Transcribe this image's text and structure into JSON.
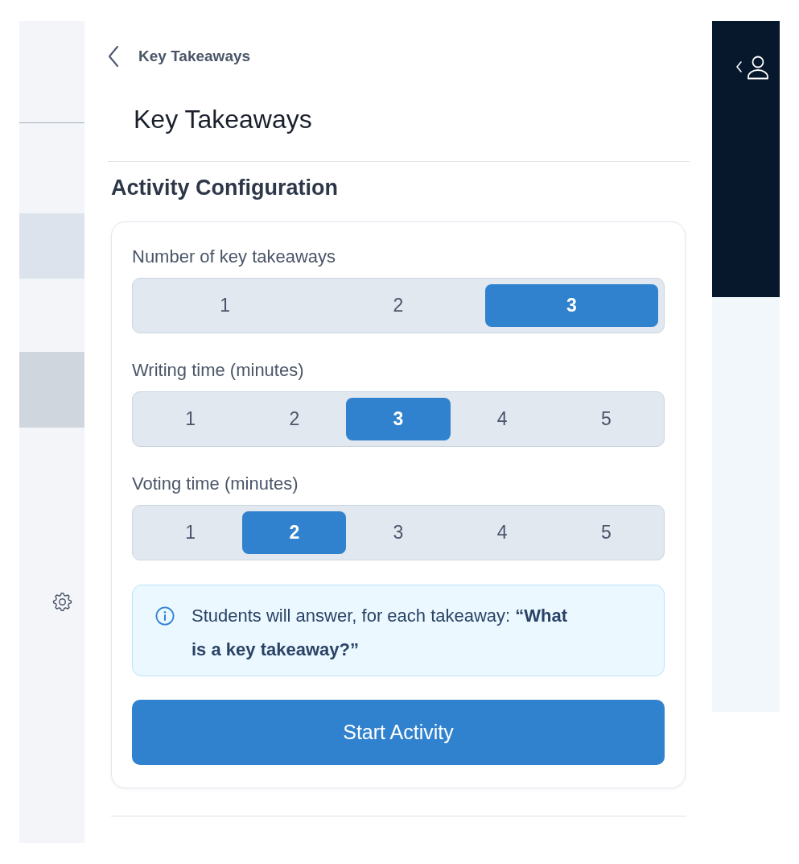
{
  "back_link": {
    "label": "Key Takeaways"
  },
  "title": "Key Takeaways",
  "section_title": "Activity Configuration",
  "settings": [
    {
      "label": "Number of key takeaways",
      "options": [
        {
          "label": "1",
          "selected": false
        },
        {
          "label": "2",
          "selected": false
        },
        {
          "label": "3",
          "selected": true
        }
      ]
    },
    {
      "label": "Writing time (minutes)",
      "options": [
        {
          "label": "1",
          "selected": false
        },
        {
          "label": "2",
          "selected": false
        },
        {
          "label": "3",
          "selected": true
        },
        {
          "label": "4",
          "selected": false
        },
        {
          "label": "5",
          "selected": false
        }
      ]
    },
    {
      "label": "Voting time (minutes)",
      "options": [
        {
          "label": "1",
          "selected": false
        },
        {
          "label": "2",
          "selected": true
        },
        {
          "label": "3",
          "selected": false
        },
        {
          "label": "4",
          "selected": false
        },
        {
          "label": "5",
          "selected": false
        }
      ]
    }
  ],
  "info_note": {
    "text": "Students will answer, for each takeaway: **“What is a key takeaway?”**"
  },
  "start_button": {
    "label": "Start Activity"
  }
}
